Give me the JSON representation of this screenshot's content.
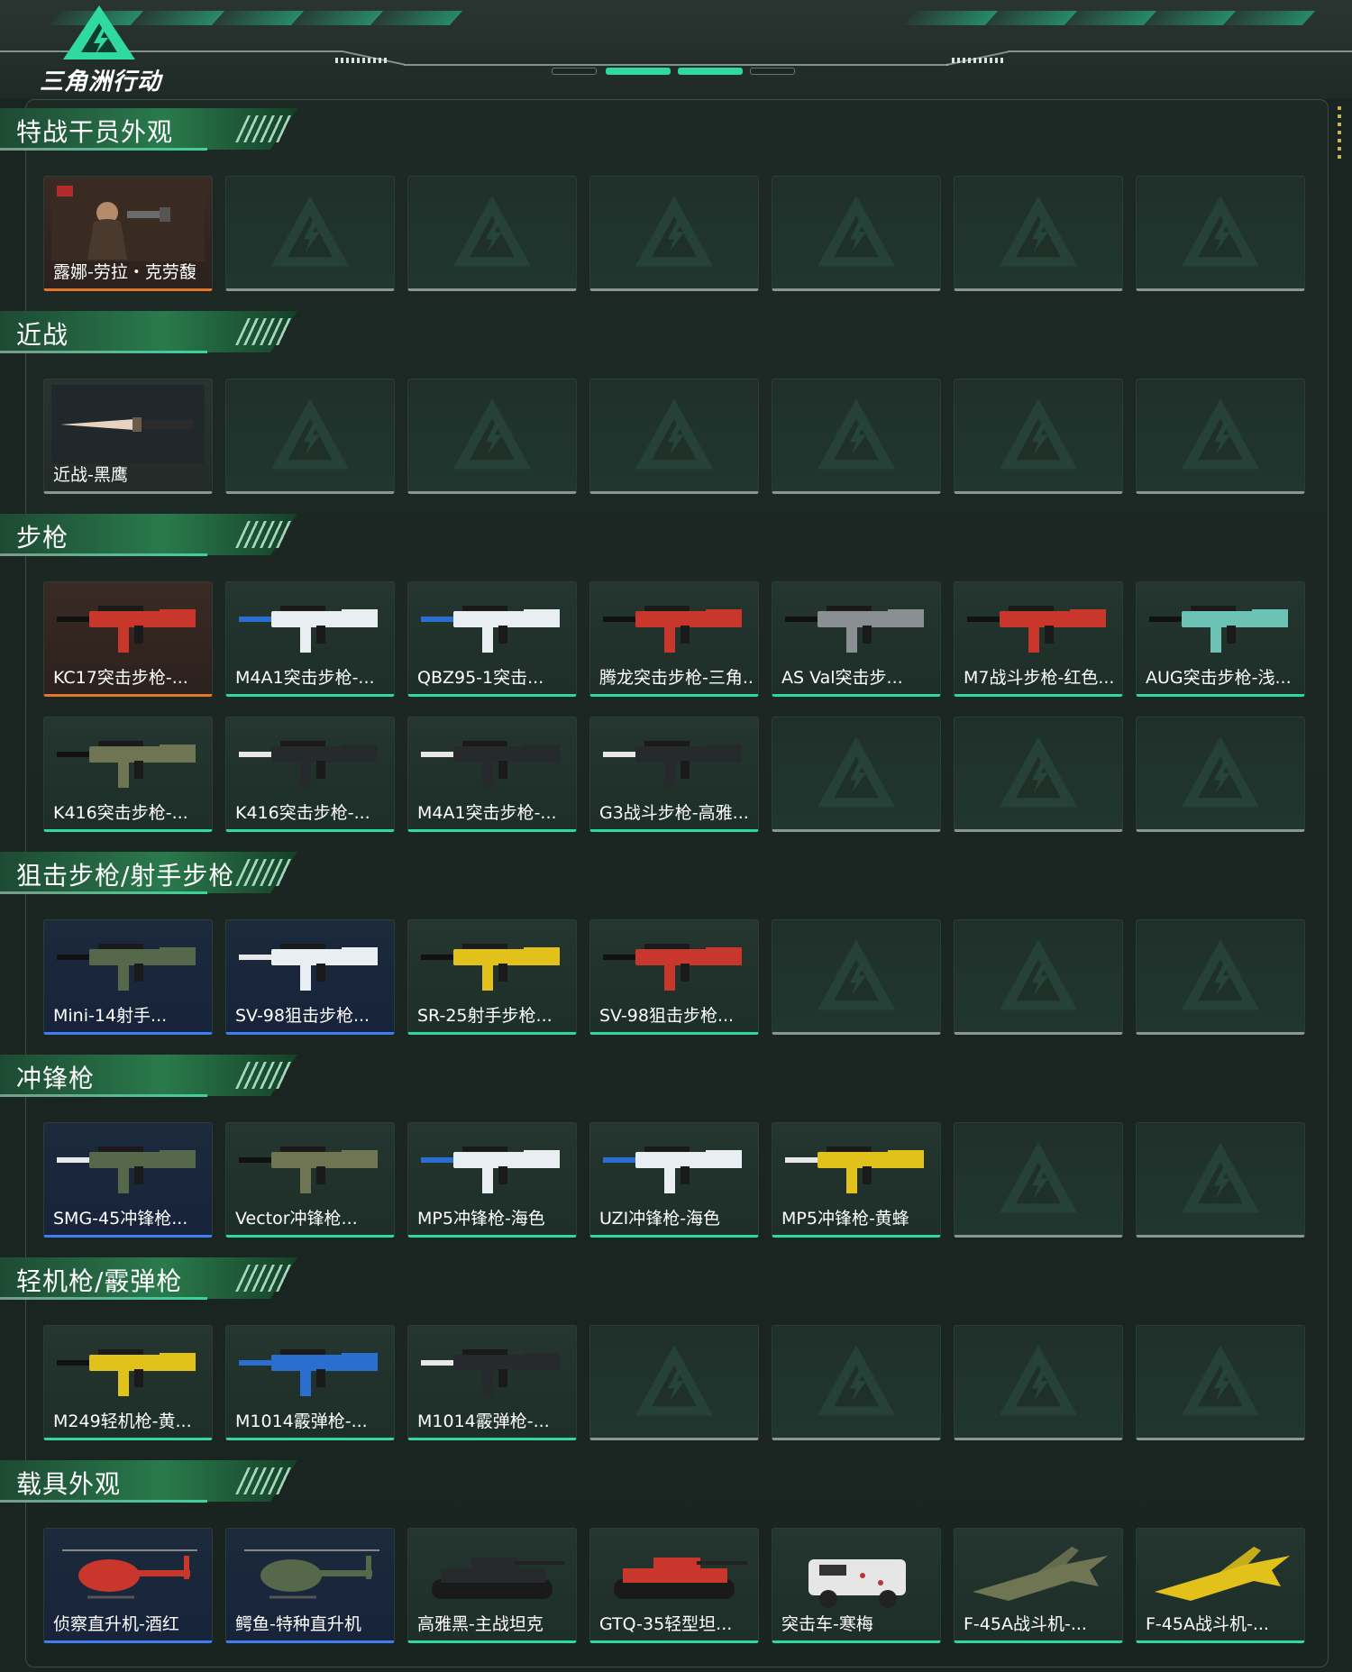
{
  "header": {
    "logo_text": "三角洲行动"
  },
  "sections": [
    {
      "title": "特战干员外观",
      "items": [
        {
          "name": "露娜-劳拉・克劳馥",
          "rarity": "orange",
          "icon": "operator-portrait"
        }
      ]
    },
    {
      "title": "近战",
      "items": [
        {
          "name": "近战-黑鹰",
          "rarity": "none",
          "icon": "knife"
        }
      ]
    },
    {
      "title": "步枪",
      "items": [
        {
          "name": "KC17突击步枪-...",
          "rarity": "orange",
          "icon": "rifle-dark-red"
        },
        {
          "name": "M4A1突击步枪-...",
          "rarity": "green",
          "icon": "rifle-white-blue"
        },
        {
          "name": "QBZ95-1突击...",
          "rarity": "green",
          "icon": "bullpup-white-blue"
        },
        {
          "name": "腾龙突击步枪-三角...",
          "rarity": "green",
          "icon": "rifle-red-pattern"
        },
        {
          "name": "AS Val突击步...",
          "rarity": "green",
          "icon": "rifle-gray-suppressed"
        },
        {
          "name": "M7战斗步枪-红色...",
          "rarity": "green",
          "icon": "rifle-red"
        },
        {
          "name": "AUG突击步枪-浅...",
          "rarity": "green",
          "icon": "bullpup-teal"
        },
        {
          "name": "K416突击步枪-...",
          "rarity": "green",
          "icon": "rifle-camo"
        },
        {
          "name": "K416突击步枪-...",
          "rarity": "green",
          "icon": "rifle-black"
        },
        {
          "name": "M4A1突击步枪-...",
          "rarity": "green",
          "icon": "rifle-black"
        },
        {
          "name": "G3战斗步枪-高雅...",
          "rarity": "green",
          "icon": "rifle-black-long"
        }
      ]
    },
    {
      "title": "狙击步枪/射手步枪",
      "items": [
        {
          "name": "Mini-14射手...",
          "rarity": "blue",
          "icon": "rifle-green-stock"
        },
        {
          "name": "SV-98狙击步枪...",
          "rarity": "blue",
          "icon": "sniper-black-white"
        },
        {
          "name": "SR-25射手步枪...",
          "rarity": "green",
          "icon": "sniper-yellow"
        },
        {
          "name": "SV-98狙击步枪...",
          "rarity": "green",
          "icon": "sniper-red"
        }
      ]
    },
    {
      "title": "冲锋枪",
      "items": [
        {
          "name": "SMG-45冲锋枪...",
          "rarity": "blue",
          "icon": "smg-black-green"
        },
        {
          "name": "Vector冲锋枪...",
          "rarity": "green",
          "icon": "smg-camo"
        },
        {
          "name": "MP5冲锋枪-海色",
          "rarity": "green",
          "icon": "smg-white-blue"
        },
        {
          "name": "UZI冲锋枪-海色",
          "rarity": "green",
          "icon": "uzi-white-blue"
        },
        {
          "name": "MP5冲锋枪-黄蜂",
          "rarity": "green",
          "icon": "smg-yellow-black"
        }
      ]
    },
    {
      "title": "轻机枪/霰弹枪",
      "items": [
        {
          "name": "M249轻机枪-黄...",
          "rarity": "green",
          "icon": "lmg-yellow"
        },
        {
          "name": "M1014霰弹枪-...",
          "rarity": "green",
          "icon": "shotgun-blue"
        },
        {
          "name": "M1014霰弹枪-...",
          "rarity": "green",
          "icon": "shotgun-black"
        }
      ]
    },
    {
      "title": "载具外观",
      "items": [
        {
          "name": "侦察直升机-酒红",
          "rarity": "blue",
          "icon": "helicopter-red"
        },
        {
          "name": "鳄鱼-特种直升机",
          "rarity": "blue",
          "icon": "helicopter-green"
        },
        {
          "name": "高雅黑-主战坦克",
          "rarity": "green",
          "icon": "tank-black"
        },
        {
          "name": "GTQ-35轻型坦...",
          "rarity": "green",
          "icon": "tank-red"
        },
        {
          "name": "突击车-寒梅",
          "rarity": "green",
          "icon": "armored-car-white"
        },
        {
          "name": "F-45A战斗机-...",
          "rarity": "green",
          "icon": "jet-camo"
        },
        {
          "name": "F-45A战斗机-...",
          "rarity": "green",
          "icon": "jet-yellow"
        }
      ]
    }
  ],
  "colors": {
    "rarity_orange": "#e4762a",
    "rarity_green": "#2fd89e",
    "rarity_blue": "#3f7ef0",
    "empty_slot": "#8c9591",
    "accent": "#2fd9a0"
  }
}
